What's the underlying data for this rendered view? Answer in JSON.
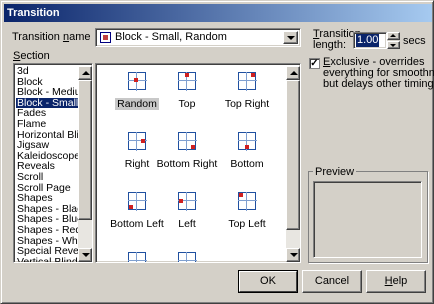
{
  "window": {
    "title": "Transition"
  },
  "transition_name": {
    "label": "Transition ",
    "label_ul": "n",
    "label_rest": "ame",
    "value": "Block - Small, Random"
  },
  "section": {
    "label_ul": "S",
    "label_rest": "ection"
  },
  "list_items": [
    "3d",
    "Block",
    "Block - Medium",
    "Block - Small",
    "Fades",
    "Flame",
    "Horizontal Blinds",
    "Jigsaw",
    "Kaleidoscope",
    "Reveals",
    "Scroll",
    "Scroll Page",
    "Shapes",
    "Shapes - Black",
    "Shapes - Blue",
    "Shapes - Red",
    "Shapes - White",
    "Special Reveals",
    "Vertical Blinds"
  ],
  "selected_item": "Block - Small",
  "transitions": [
    {
      "label": "Random",
      "selected": true
    },
    {
      "label": "Top"
    },
    {
      "label": "Top Right"
    },
    {
      "label": "Right"
    },
    {
      "label": "Bottom Right"
    },
    {
      "label": "Bottom"
    },
    {
      "label": "Bottom Left"
    },
    {
      "label": "Left"
    },
    {
      "label": "Top Left"
    }
  ],
  "transition_length": {
    "label_ul": "T",
    "label_rest": "ransition",
    "label2": "length:",
    "value": "1.00",
    "unit": "secs"
  },
  "exclusive": {
    "checked": true,
    "line1_ul": "E",
    "line1_rest": "xclusive - overrides",
    "line2": "everything for smoothness",
    "line3": "but delays other timings"
  },
  "preview": {
    "label": "Preview"
  },
  "buttons": {
    "ok": "OK",
    "cancel": "Cancel",
    "help_ul": "H",
    "help_rest": "elp"
  }
}
